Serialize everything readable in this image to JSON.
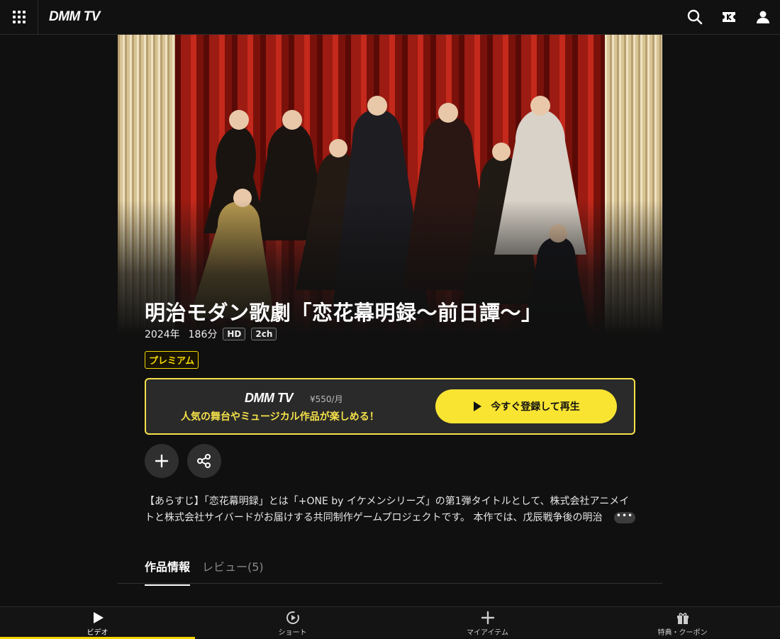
{
  "header": {
    "logo": "DMM TV",
    "icons": [
      "menu-grid-icon",
      "search-icon",
      "ticket-icon",
      "account-icon"
    ]
  },
  "title": "明治モダン歌劇「恋花幕明録～前日譚～」",
  "meta": {
    "year": "2024年",
    "duration": "186分",
    "quality": "HD",
    "audio": "2ch"
  },
  "badge": "プレミアム",
  "promo": {
    "logo": "DMM TV",
    "price": "¥550/月",
    "copy": "人気の舞台やミュージカル作品が楽しめる！",
    "cta": "今すぐ登録して再生"
  },
  "synopsis": "【あらすじ】「恋花幕明録」とは「+ONE by イケメンシリーズ」の第1弾タイトルとして、株式会社アニメイトと株式会社サイバードがお届けする共同制作ゲームプロジェクトです。 本作では、戊辰戦争後の明治",
  "more_label": "•••",
  "tabs": [
    {
      "label": "作品情報"
    },
    {
      "label": "レビュー(5)"
    }
  ],
  "bottom_nav": [
    {
      "label": "ビデオ"
    },
    {
      "label": "ショート"
    },
    {
      "label": "マイアイテム"
    },
    {
      "label": "特典・クーポン"
    }
  ],
  "colors": {
    "accent": "#f5d600",
    "background": "#101010"
  }
}
